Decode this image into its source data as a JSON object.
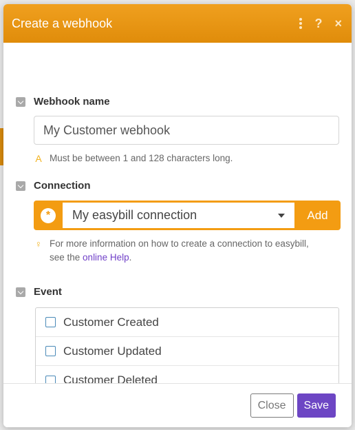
{
  "dialog": {
    "title": "Create a webhook",
    "help_icon": "?",
    "close_icon": "×"
  },
  "webhook_name": {
    "label": "Webhook name",
    "value": "My Customer webhook",
    "hint_icon": "A",
    "hint": "Must be between 1 and 128 characters long."
  },
  "connection": {
    "label": "Connection",
    "selected": "My easybill connection",
    "icon": "*",
    "add_label": "Add",
    "hint_icon": "♀",
    "hint_line1": "For more information on how to create a connection to easybill,",
    "hint_line2_prefix": "see the ",
    "hint_link": "online Help",
    "hint_suffix": "."
  },
  "event": {
    "label": "Event",
    "options": [
      {
        "label": "Customer Created"
      },
      {
        "label": "Customer Updated"
      },
      {
        "label": "Customer Deleted"
      }
    ]
  },
  "footer": {
    "close_label": "Close",
    "save_label": "Save"
  },
  "colors": {
    "header": "#f39c12",
    "accent": "#6d46c4",
    "link": "#7040c8"
  }
}
